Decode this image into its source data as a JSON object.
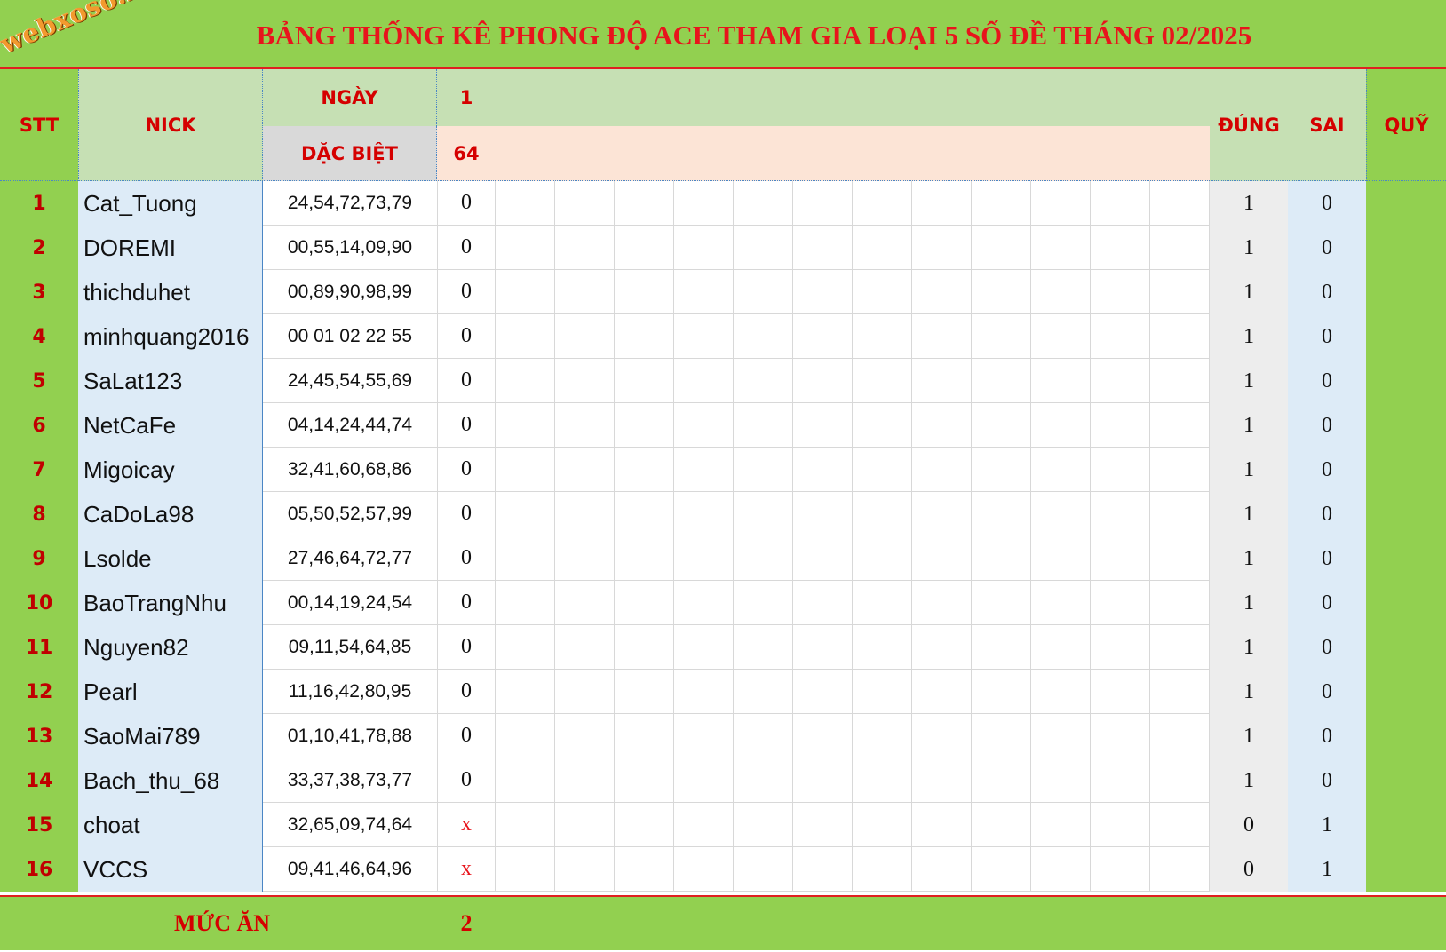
{
  "title": "BẢNG THỐNG KÊ PHONG ĐỘ ACE THAM GIA LOẠI 5 SỐ ĐỀ THÁNG 02/2025",
  "logo_text": "webxoso.net",
  "headers": {
    "stt": "STT",
    "nick": "NICK",
    "ngay": "NGÀY",
    "dac_biet": "DẶC BIỆT",
    "dung": "ĐÚNG",
    "sai": "SAI",
    "quy": "QUỸ"
  },
  "day_value": "1",
  "special_value": "64",
  "rows": [
    {
      "stt": "1",
      "nick": "Cat_Tuong",
      "numbers": "24,54,72,73,79",
      "day1": "0",
      "dung": "1",
      "sai": "0"
    },
    {
      "stt": "2",
      "nick": "DOREMI",
      "numbers": "00,55,14,09,90",
      "day1": "0",
      "dung": "1",
      "sai": "0"
    },
    {
      "stt": "3",
      "nick": "thichduhet",
      "numbers": "00,89,90,98,99",
      "day1": "0",
      "dung": "1",
      "sai": "0"
    },
    {
      "stt": "4",
      "nick": "minhquang2016",
      "numbers": "00 01 02 22 55",
      "day1": "0",
      "dung": "1",
      "sai": "0"
    },
    {
      "stt": "5",
      "nick": "SaLat123",
      "numbers": "24,45,54,55,69",
      "day1": "0",
      "dung": "1",
      "sai": "0"
    },
    {
      "stt": "6",
      "nick": "NetCaFe",
      "numbers": "04,14,24,44,74",
      "day1": "0",
      "dung": "1",
      "sai": "0"
    },
    {
      "stt": "7",
      "nick": "Migoicay",
      "numbers": "32,41,60,68,86",
      "day1": "0",
      "dung": "1",
      "sai": "0"
    },
    {
      "stt": "8",
      "nick": "CaDoLa98",
      "numbers": "05,50,52,57,99",
      "day1": "0",
      "dung": "1",
      "sai": "0"
    },
    {
      "stt": "9",
      "nick": "Lsolde",
      "numbers": "27,46,64,72,77",
      "day1": "0",
      "dung": "1",
      "sai": "0"
    },
    {
      "stt": "10",
      "nick": "BaoTrangNhu",
      "numbers": "00,14,19,24,54",
      "day1": "0",
      "dung": "1",
      "sai": "0"
    },
    {
      "stt": "11",
      "nick": "Nguyen82",
      "numbers": "09,11,54,64,85",
      "day1": "0",
      "dung": "1",
      "sai": "0"
    },
    {
      "stt": "12",
      "nick": "Pearl",
      "numbers": "11,16,42,80,95",
      "day1": "0",
      "dung": "1",
      "sai": "0"
    },
    {
      "stt": "13",
      "nick": "SaoMai789",
      "numbers": "01,10,41,78,88",
      "day1": "0",
      "dung": "1",
      "sai": "0"
    },
    {
      "stt": "14",
      "nick": "Bach_thu_68",
      "numbers": "33,37,38,73,77",
      "day1": "0",
      "dung": "1",
      "sai": "0"
    },
    {
      "stt": "15",
      "nick": "choat",
      "numbers": "32,65,09,74,64",
      "day1": "x",
      "dung": "0",
      "sai": "1"
    },
    {
      "stt": "16",
      "nick": "VCCS",
      "numbers": "09,41,46,64,96",
      "day1": "x",
      "dung": "0",
      "sai": "1"
    }
  ],
  "footer": {
    "label": "MỨC ĂN",
    "value": "2"
  },
  "colors": {
    "green": "#92d050",
    "red_text": "#e8141c",
    "light_blue": "#ddebf7",
    "light_green": "#c6e0b4",
    "peach": "#fce4d6",
    "gray": "#ededed"
  }
}
